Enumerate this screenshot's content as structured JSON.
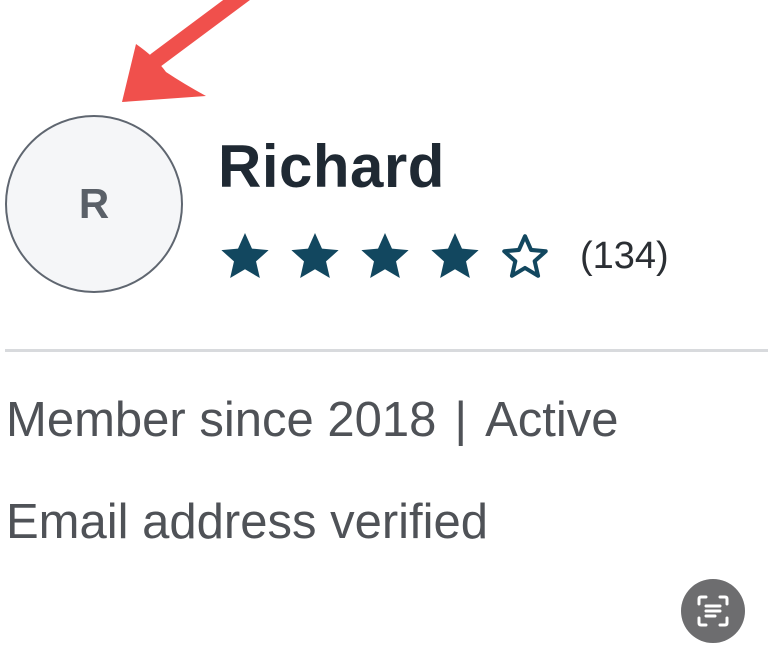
{
  "profile": {
    "avatar_initial": "R",
    "name": "Richard",
    "rating": {
      "stars": 4,
      "max_stars": 5,
      "review_count_label": "(134)"
    },
    "member_since_label": "Member since 2018",
    "separator": "|",
    "status_label": "Active",
    "verified_label": "Email address verified"
  },
  "colors": {
    "star_fill": "#12475f",
    "annotation_arrow": "#f0504c"
  },
  "icons": {
    "annotation": "red-arrow-icon",
    "scan_text": "text-scan-icon"
  }
}
